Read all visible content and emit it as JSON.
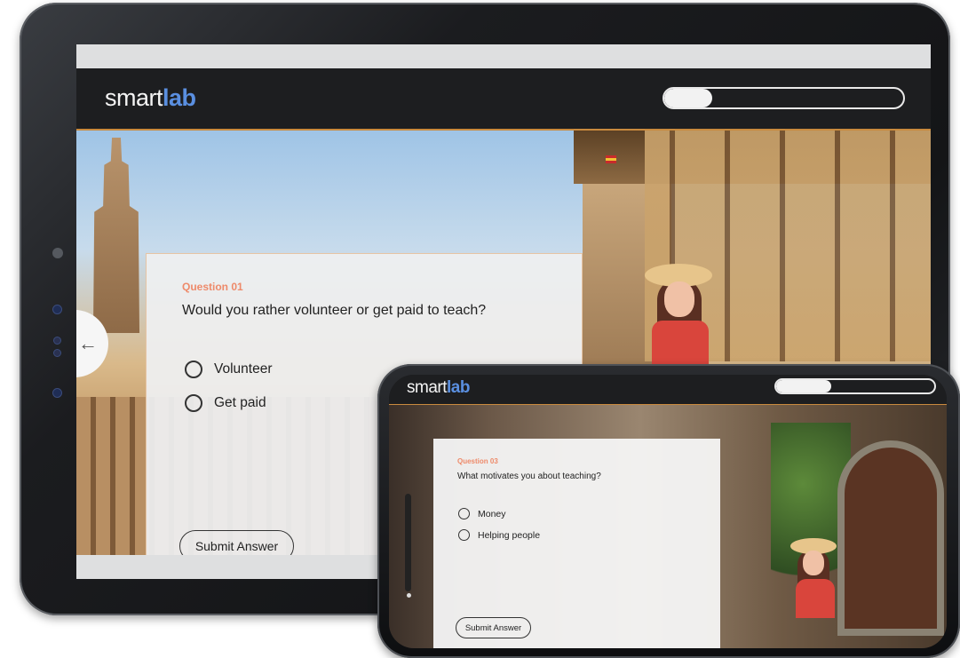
{
  "tablet": {
    "brand": {
      "main": "smart",
      "accent": "lab"
    },
    "progress": 0.2,
    "question": {
      "number": "Question 01",
      "text": "Would you rather volunteer or get paid to teach?",
      "options": [
        "Volunteer",
        "Get paid"
      ],
      "submit_label": "Submit Answer"
    },
    "back_icon": "arrow-left-icon"
  },
  "phone": {
    "brand": {
      "main": "smart",
      "accent": "lab"
    },
    "progress": 0.35,
    "question": {
      "number": "Question 03",
      "text": "What motivates you about teaching?",
      "options": [
        "Money",
        "Helping people"
      ],
      "submit_label": "Submit Answer"
    }
  },
  "colors": {
    "accent_blue": "#5a8fe0",
    "question_number": "#ee8a6a",
    "header_bg": "#1d1e20",
    "header_border": "#c98a3e"
  }
}
